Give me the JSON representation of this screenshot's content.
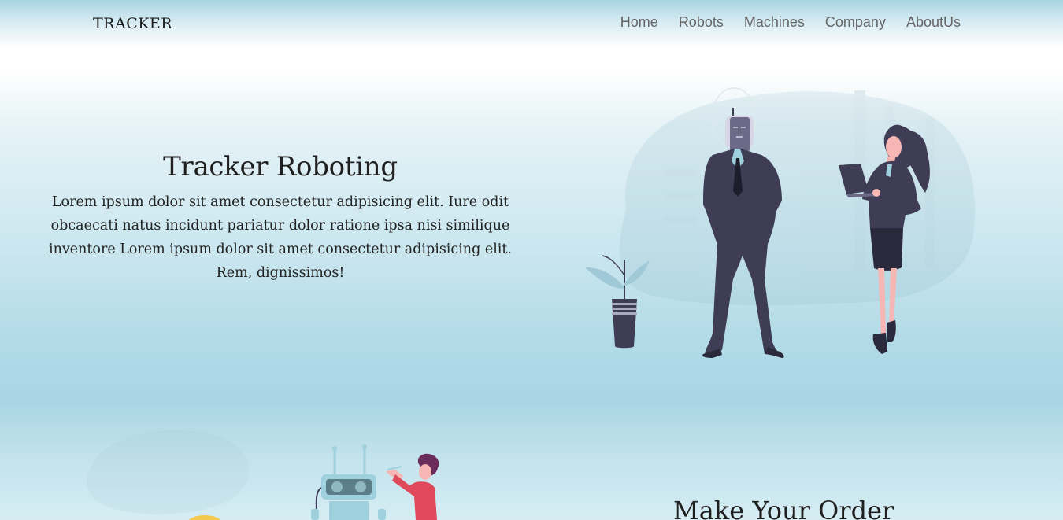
{
  "navbar": {
    "brand": "TRACKER",
    "links": [
      {
        "label": "Home"
      },
      {
        "label": "Robots"
      },
      {
        "label": "Machines"
      },
      {
        "label": "Company"
      },
      {
        "label": "AboutUs"
      }
    ]
  },
  "hero": {
    "title": "Tracker Roboting",
    "body": "Lorem ipsum dolor sit amet consectetur adipisicing elit. Iure odit obcaecati natus incidunt pariatur dolor ratione ipsa nisi similique inventore Lorem ipsum dolor sit amet consectetur adipisicing elit. Rem, dignissimos!"
  },
  "order_section": {
    "title": "Make Your Order"
  },
  "colors": {
    "suit": "#3f3d56",
    "skin": "#f6b6b4",
    "accent_red": "#e0495a",
    "robot_blue": "#9fd0de",
    "plant": "#9fc9d6"
  }
}
